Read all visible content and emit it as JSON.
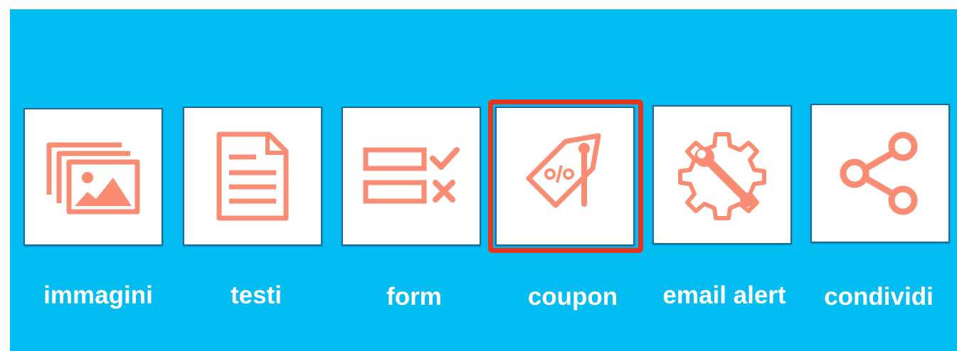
{
  "colors": {
    "background": "#03BDF2",
    "tile": "#FFFFFF",
    "icon": "#FB8C74",
    "highlight": "#E8341C",
    "label": "#FFFFFF"
  },
  "tiles": [
    {
      "id": "immagini",
      "label": "immagini",
      "icon": "images-icon"
    },
    {
      "id": "testi",
      "label": "testi",
      "icon": "document-icon"
    },
    {
      "id": "form",
      "label": "form",
      "icon": "form-checklist-icon"
    },
    {
      "id": "coupon",
      "label": "coupon",
      "icon": "coupon-tag-icon",
      "highlighted": true
    },
    {
      "id": "email-alert",
      "label": "email alert",
      "icon": "gear-wrench-icon"
    },
    {
      "id": "condividi",
      "label": "condividi",
      "icon": "share-icon"
    }
  ]
}
